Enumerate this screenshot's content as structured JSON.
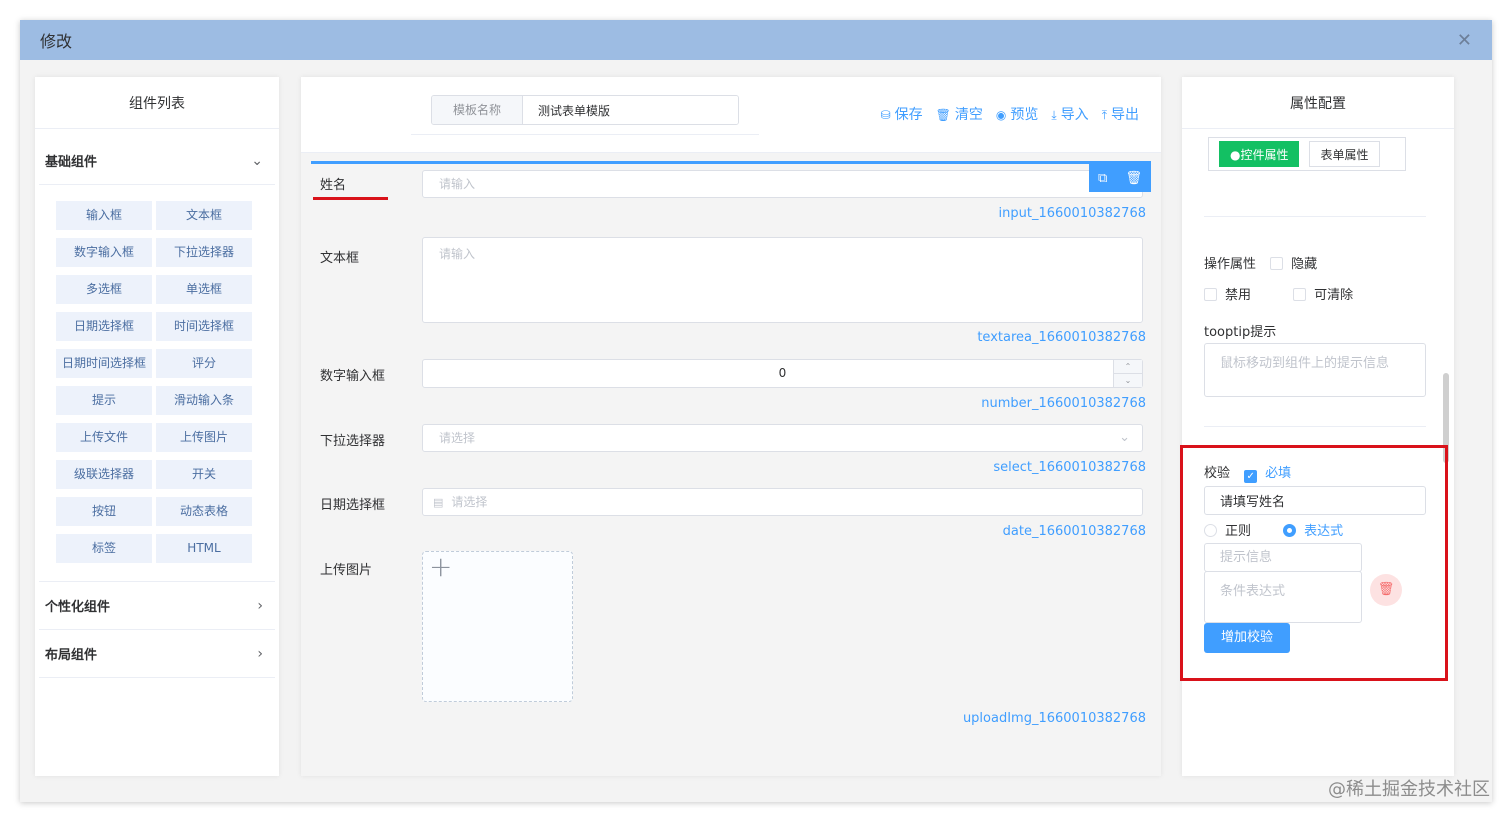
{
  "dialog": {
    "title": "修改",
    "close_icon": "close-icon"
  },
  "component_list": {
    "title": "组件列表",
    "groups": [
      {
        "label": "基础组件",
        "expanded": true,
        "items": [
          "输入框",
          "文本框",
          "数字输入框",
          "下拉选择器",
          "多选框",
          "单选框",
          "日期选择框",
          "时间选择框",
          "日期时间选择框",
          "评分",
          "提示",
          "滑动输入条",
          "上传文件",
          "上传图片",
          "级联选择器",
          "开关",
          "按钮",
          "动态表格",
          "标签",
          "HTML"
        ]
      },
      {
        "label": "个性化组件",
        "expanded": false
      },
      {
        "label": "布局组件",
        "expanded": false
      }
    ]
  },
  "toolbar": {
    "template_label": "模板名称",
    "template_value": "测试表单模版",
    "actions": [
      {
        "icon": "database-icon",
        "label": "保存"
      },
      {
        "icon": "trash-icon",
        "label": "清空"
      },
      {
        "icon": "eye-icon",
        "label": "预览"
      },
      {
        "icon": "download-icon",
        "label": "导入"
      },
      {
        "icon": "upload-icon",
        "label": "导出"
      }
    ]
  },
  "form": {
    "fields": [
      {
        "label": "姓名",
        "placeholder": "请输入",
        "id": "input_1660010382768"
      },
      {
        "label": "文本框",
        "placeholder": "请输入",
        "id": "textarea_1660010382768"
      },
      {
        "label": "数字输入框",
        "value": "0",
        "id": "number_1660010382768"
      },
      {
        "label": "下拉选择器",
        "placeholder": "请选择",
        "id": "select_1660010382768"
      },
      {
        "label": "日期选择框",
        "placeholder": "请选择",
        "id": "date_1660010382768"
      },
      {
        "label": "上传图片",
        "id": "uploadImg_1660010382768"
      }
    ]
  },
  "properties": {
    "title": "属性配置",
    "tabs": {
      "control": "●控件属性",
      "form": "表单属性"
    },
    "operation": {
      "label": "操作属性",
      "hide": "隐藏",
      "disable": "禁用",
      "clearable": "可清除"
    },
    "tooltip": {
      "label": "tooptip提示",
      "placeholder": "鼠标移动到组件上的提示信息"
    },
    "validation": {
      "label": "校验",
      "required_label": "必填",
      "required_checked": true,
      "message_value": "请填写姓名",
      "regex_label": "正则",
      "expression_label": "表达式",
      "selected_mode": "表达式",
      "hint_placeholder": "提示信息",
      "condition_placeholder": "条件表达式",
      "add_button": "增加校验"
    }
  },
  "watermark": "@稀土掘金技术社区",
  "colors": {
    "accent": "#409eff",
    "header": "#9dbce3",
    "tab_active": "#13c063",
    "highlight": "#d9121a"
  }
}
